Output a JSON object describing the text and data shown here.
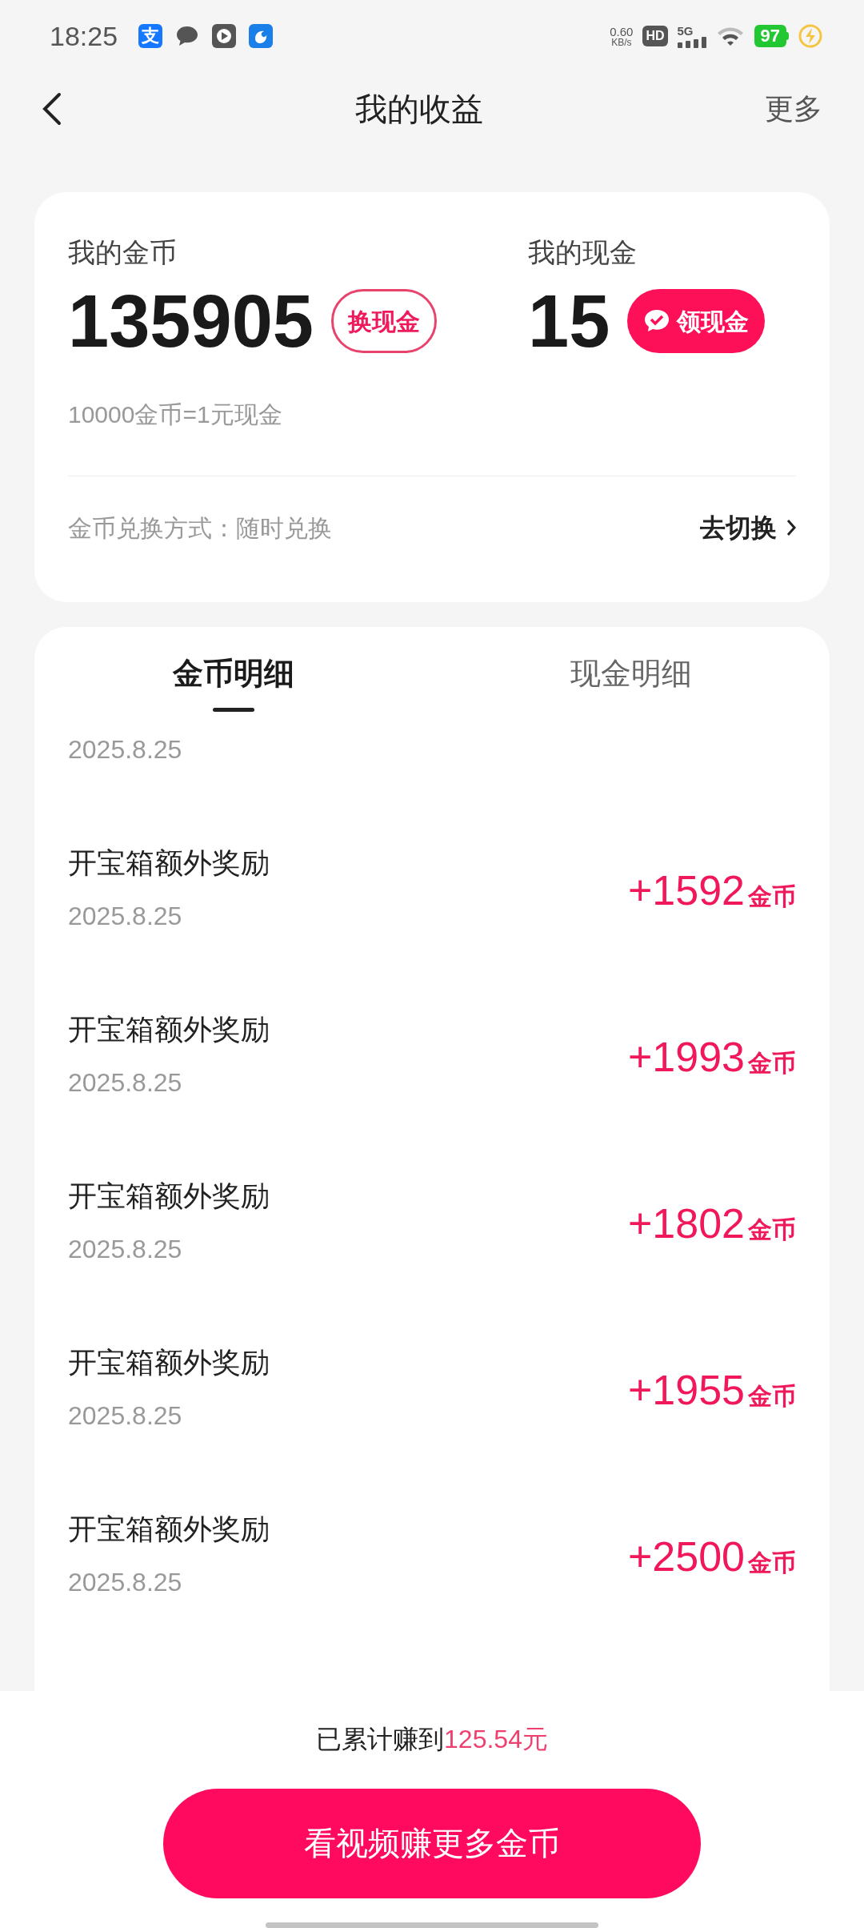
{
  "status_bar": {
    "time": "18:25",
    "app_icons": [
      {
        "kind": "text",
        "label": "支"
      },
      {
        "kind": "chat"
      },
      {
        "kind": "play"
      },
      {
        "kind": "bird"
      }
    ],
    "net_speed": "0.60",
    "net_unit": "KB/s",
    "hd": "HD",
    "network": "5G",
    "battery": "97",
    "charging": true
  },
  "header": {
    "title": "我的收益",
    "more": "更多"
  },
  "summary": {
    "coins_label": "我的金币",
    "coins": "135905",
    "coins_button": "换现金",
    "cash_label": "我的现金",
    "cash": "15",
    "cash_button": "领现金",
    "rate": "10000金币=1元现金",
    "method_label": "金币兑换方式：",
    "method_value": "随时兑换",
    "switch_link": "去切换"
  },
  "tabs": [
    {
      "label": "金币明细",
      "selected": true
    },
    {
      "label": "现金明细",
      "selected": false
    }
  ],
  "records": [
    {
      "date": "2025.8.25"
    },
    {
      "title": "开宝箱额外奖励",
      "date": "2025.8.25",
      "amount": "+1592",
      "unit": "金币"
    },
    {
      "title": "开宝箱额外奖励",
      "date": "2025.8.25",
      "amount": "+1993",
      "unit": "金币"
    },
    {
      "title": "开宝箱额外奖励",
      "date": "2025.8.25",
      "amount": "+1802",
      "unit": "金币"
    },
    {
      "title": "开宝箱额外奖励",
      "date": "2025.8.25",
      "amount": "+1955",
      "unit": "金币"
    },
    {
      "title": "开宝箱额外奖励",
      "date": "2025.8.25",
      "amount": "+2500",
      "unit": "金币"
    }
  ],
  "footer": {
    "total_label": "已累计赚到",
    "total_value": "125.54元",
    "button": "看视频赚更多金币"
  }
}
